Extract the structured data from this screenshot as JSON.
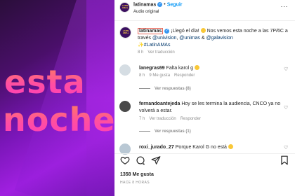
{
  "media": {
    "line1": "esta",
    "line2": "noche"
  },
  "header": {
    "username": "latinamas",
    "separator": "•",
    "follow_label": "Seguir",
    "audio_label": "Audio original",
    "more_label": "···",
    "avatar_text": "LATIN AMAs"
  },
  "caption": {
    "username": "latinamas",
    "text_1": "¡Llegó el día! ",
    "text_2": " Nos vemos esta noche a las 7P/6C a través ",
    "mention_1": "@univision",
    "sep_1": ", ",
    "mention_2": "@unimas",
    "sep_2": " & ",
    "mention_3": "@galavision",
    "sparkle": "✨",
    "hashtag": "#LatinAMAs",
    "time": "8 h",
    "translate": "Ver traducción"
  },
  "comments": [
    {
      "username": "lanegras69",
      "text": "Falta karol g",
      "time": "8 h",
      "likes": "9 Me gusta",
      "reply": "Responder",
      "replies": "Ver respuestas (8)"
    },
    {
      "username": "fernandoantejeda",
      "text": "Hoy se les termina la audiencia, CNCO ya no volverá a estar.",
      "time": "7 h",
      "translate": "Ver traducción",
      "reply": "Responder",
      "replies": "Ver respuestas (1)"
    },
    {
      "username": "roxi_jurado_27",
      "text": "Porque Karol G no está"
    }
  ],
  "footer": {
    "likes": "1358 Me gusta",
    "ago": "HACE 8 HORAS"
  },
  "colors": {
    "link_blue": "#0095f6",
    "verified_blue": "#3897f0",
    "mention_blue": "#00376b",
    "muted": "#8e8e8e",
    "text": "#262626"
  }
}
